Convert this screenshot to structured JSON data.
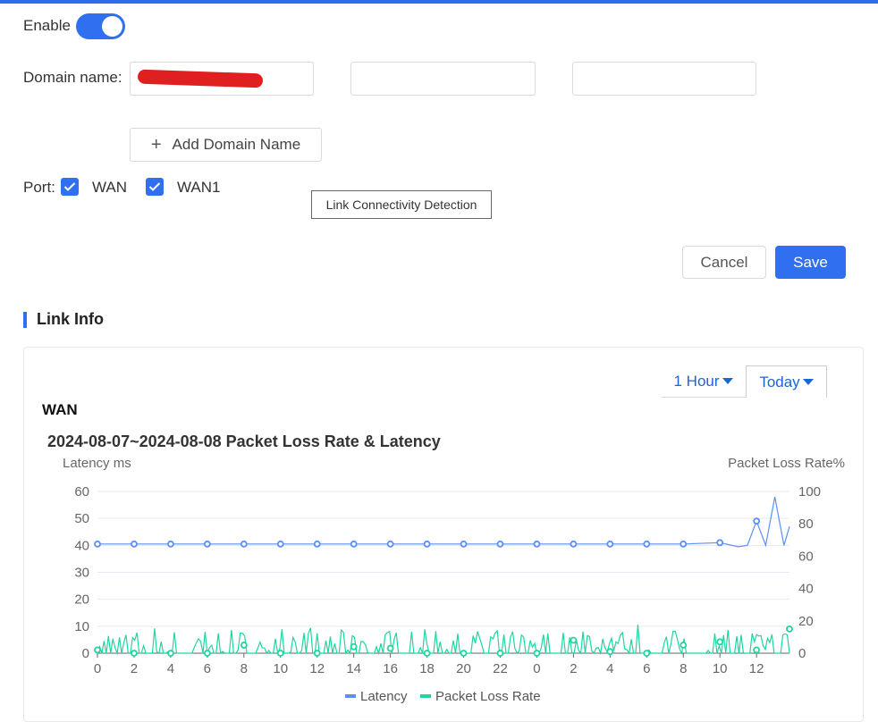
{
  "form": {
    "enable_label": "Enable",
    "enable_on": true,
    "domain_label": "Domain name:",
    "domain_values": [
      "",
      "",
      ""
    ],
    "add_domain_label": "Add Domain Name",
    "port_label": "Port:",
    "ports": [
      {
        "label": "WAN",
        "checked": true
      },
      {
        "label": "WAN1",
        "checked": true
      }
    ],
    "tooltip": "Link Connectivity Detection",
    "cancel_label": "Cancel",
    "save_label": "Save"
  },
  "link_info": {
    "section_title": "Link Info",
    "tabs": [
      {
        "label": "1 Hour",
        "active": false
      },
      {
        "label": "Today",
        "active": true
      }
    ],
    "interface_title": "WAN"
  },
  "colors": {
    "accent": "#2f6ff0",
    "latency": "#5b8ff9",
    "loss": "#1fd6a1"
  },
  "icons": {
    "add": "plus-icon",
    "checkbox": "checkmark-icon",
    "dropdown": "caret-down-icon"
  },
  "chart_data": {
    "type": "line",
    "title": "2024-08-07~2024-08-08 Packet Loss Rate & Latency",
    "ylabel": "Latency ms",
    "y2label": "Packet Loss Rate%",
    "ylim": [
      0,
      60
    ],
    "y2lim": [
      0,
      100
    ],
    "yticks": [
      0,
      10,
      20,
      30,
      40,
      50,
      60
    ],
    "y2ticks": [
      0,
      20,
      40,
      60,
      80,
      100
    ],
    "xtick_labels": [
      "0",
      "2",
      "4",
      "6",
      "8",
      "10",
      "12",
      "14",
      "16",
      "18",
      "20",
      "22",
      "0",
      "2",
      "4",
      "6",
      "8",
      "10",
      "12"
    ],
    "grid": true,
    "legend": "bottom",
    "series": [
      {
        "name": "Latency",
        "axis": "left",
        "x": [
          0,
          2,
          4,
          6,
          8,
          10,
          12,
          14,
          16,
          18,
          20,
          22,
          24,
          26,
          28,
          30,
          32,
          34,
          35,
          35.5,
          36,
          36.5,
          37,
          37.5,
          37.8
        ],
        "values": [
          40.5,
          40.5,
          40.5,
          40.5,
          40.5,
          40.5,
          40.5,
          40.5,
          40.5,
          40.5,
          40.5,
          40.5,
          40.5,
          40.5,
          40.5,
          40.5,
          40.5,
          41,
          39.5,
          40,
          49,
          40,
          58,
          40,
          47
        ]
      },
      {
        "name": "Packet Loss Rate",
        "axis": "right",
        "x": [
          0,
          2,
          4,
          6,
          8,
          10,
          12,
          14,
          16,
          18,
          20,
          22,
          24,
          26,
          28,
          30,
          32,
          34,
          36,
          37.8
        ],
        "values": [
          2,
          0,
          0,
          0,
          5,
          0,
          0,
          4,
          3,
          0,
          0,
          0,
          0,
          8,
          1,
          0,
          5,
          7,
          2,
          15
        ]
      }
    ]
  }
}
